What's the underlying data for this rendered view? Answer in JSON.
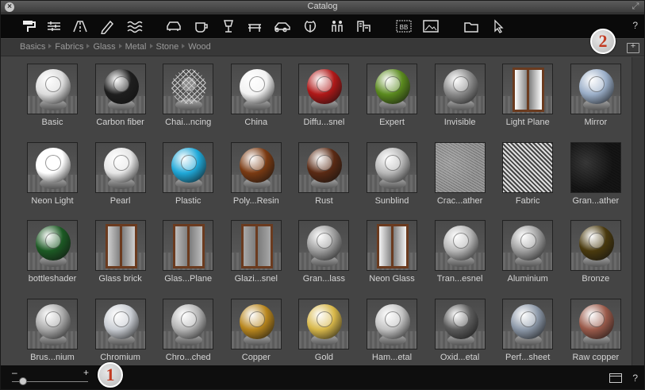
{
  "window": {
    "title": "Catalog",
    "help": "?"
  },
  "toolbar": {
    "tools": [
      {
        "name": "paint-roller-icon"
      },
      {
        "name": "layers-icon"
      },
      {
        "name": "road-icon"
      },
      {
        "name": "pen-icon"
      },
      {
        "name": "water-icon"
      },
      {
        "name": "car-icon"
      },
      {
        "name": "cup-icon"
      },
      {
        "name": "lamp-icon"
      },
      {
        "name": "table-icon"
      },
      {
        "name": "car-side-icon"
      },
      {
        "name": "leaf-icon"
      },
      {
        "name": "people-icon"
      },
      {
        "name": "buildings-icon"
      },
      {
        "name": "text-box-icon"
      },
      {
        "name": "image-icon"
      },
      {
        "name": "folder-icon"
      },
      {
        "name": "pointer-icon"
      }
    ]
  },
  "breadcrumbs": [
    "Basics",
    "Fabrics",
    "Glass",
    "Metal",
    "Stone",
    "Wood"
  ],
  "markers": {
    "one": "1",
    "two": "2"
  },
  "materials": [
    {
      "label": "Basic",
      "kind": "ball",
      "color": "#dcdcdc"
    },
    {
      "label": "Carbon fiber",
      "kind": "ball",
      "color": "#1e1e1e"
    },
    {
      "label": "Chai...ncing",
      "kind": "wire",
      "color": "#cccccc"
    },
    {
      "label": "China",
      "kind": "ball",
      "color": "#f2f2f2"
    },
    {
      "label": "Diffu...snel",
      "kind": "ball",
      "color": "#b01818"
    },
    {
      "label": "Expert",
      "kind": "ball",
      "color": "#5a8a1e"
    },
    {
      "label": "Invisible",
      "kind": "ball",
      "color": "#8a8a8a"
    },
    {
      "label": "Light Plane",
      "kind": "pane",
      "color": "#ffffff"
    },
    {
      "label": "Mirror",
      "kind": "ball",
      "color": "#9aaec8"
    },
    {
      "label": "Neon Light",
      "kind": "ball",
      "color": "#ffffff"
    },
    {
      "label": "Pearl",
      "kind": "ball",
      "color": "#e6e6e6"
    },
    {
      "label": "Plastic",
      "kind": "ball",
      "color": "#1fa8d8"
    },
    {
      "label": "Poly...Resin",
      "kind": "ball",
      "color": "#7a3a12"
    },
    {
      "label": "Rust",
      "kind": "ball",
      "color": "#5a2a14"
    },
    {
      "label": "Sunblind",
      "kind": "ball",
      "color": "#b8b8b8"
    },
    {
      "label": "Crac...ather",
      "kind": "texture",
      "color": "#9a9a9a"
    },
    {
      "label": "Fabric",
      "kind": "fabric",
      "color": "#e0e0e0"
    },
    {
      "label": "Gran...ather",
      "kind": "texture",
      "color": "#151515"
    },
    {
      "label": "bottleshader",
      "kind": "ball",
      "color": "#1c5a24"
    },
    {
      "label": "Glass brick",
      "kind": "pane",
      "color": "#cfcfcf"
    },
    {
      "label": "Glas...Plane",
      "kind": "pane",
      "color": "#bdbdbd"
    },
    {
      "label": "Glazi...snel",
      "kind": "pane",
      "color": "#a8a8a8"
    },
    {
      "label": "Gran...lass",
      "kind": "ball",
      "color": "#9c9c9c"
    },
    {
      "label": "Neon Glass",
      "kind": "pane",
      "color": "#f4f4f4"
    },
    {
      "label": "Tran...esnel",
      "kind": "ball",
      "color": "#b6b6b6"
    },
    {
      "label": "Aluminium",
      "kind": "ball",
      "color": "#9e9e9e"
    },
    {
      "label": "Bronze",
      "kind": "ball",
      "color": "#4a3a0e"
    },
    {
      "label": "Brus...nium",
      "kind": "ball",
      "color": "#a9a9a9"
    },
    {
      "label": "Chromium",
      "kind": "ball",
      "color": "#c8ccd2"
    },
    {
      "label": "Chro...ched",
      "kind": "ball",
      "color": "#b4b4b4"
    },
    {
      "label": "Copper",
      "kind": "ball",
      "color": "#b8861e"
    },
    {
      "label": "Gold",
      "kind": "ball",
      "color": "#d8b84a"
    },
    {
      "label": "Ham...etal",
      "kind": "ball",
      "color": "#c2c2c2"
    },
    {
      "label": "Oxid...etal",
      "kind": "ball",
      "color": "#5a5a5a"
    },
    {
      "label": "Perf...sheet",
      "kind": "ball",
      "color": "#8c98a8"
    },
    {
      "label": "Raw copper",
      "kind": "ball",
      "color": "#9a5a4a"
    }
  ],
  "zoom": {
    "minus": "–",
    "plus": "+",
    "level": 0.15
  },
  "footer": {
    "help": "?"
  }
}
